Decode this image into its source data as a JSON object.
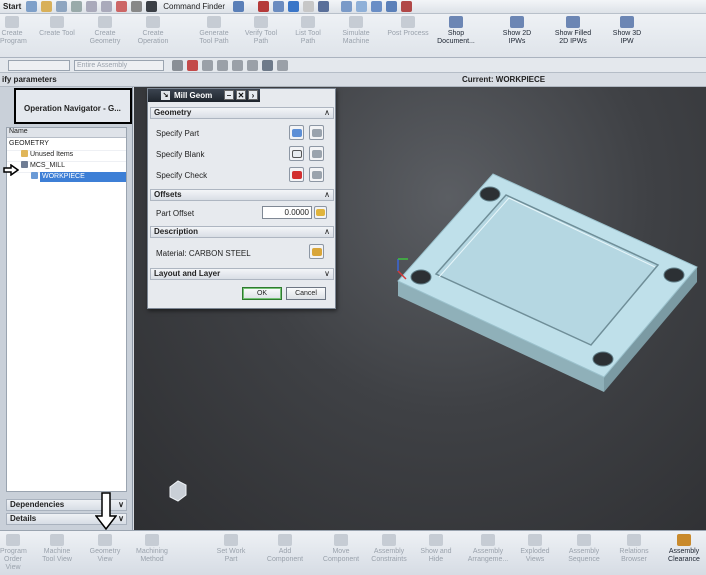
{
  "topbar": {
    "start_label": "Start",
    "command_finder_label": "Command Finder"
  },
  "ribbon": {
    "buttons": [
      {
        "label": "Create\nProgram"
      },
      {
        "label": "Create Tool"
      },
      {
        "label": "Create\nGeometry"
      },
      {
        "label": "Create\nOperation"
      },
      {
        "label": "Generate\nTool Path"
      },
      {
        "label": "Verify Tool\nPath"
      },
      {
        "label": "List Tool\nPath"
      },
      {
        "label": "Simulate\nMachine"
      },
      {
        "label": "Post Process"
      },
      {
        "label": "Shop\nDocument..."
      },
      {
        "label": "Show 2D\nIPWs"
      },
      {
        "label": "Show Filled\n2D IPWs"
      },
      {
        "label": "Show 3D\nIPW"
      }
    ]
  },
  "filterbar": {
    "assembly_select": "Entire Assembly"
  },
  "status": {
    "prompt": "ify parameters",
    "current": "Current: WORKPIECE"
  },
  "navigator": {
    "title": "Operation Navigator - G...",
    "column_header": "Name",
    "nodes": {
      "root": "GEOMETRY",
      "unused": "Unused Items",
      "mcs": "MCS_MILL",
      "workpiece": "WORKPIECE"
    },
    "sections": {
      "dependencies": "Dependencies",
      "details": "Details"
    }
  },
  "dialog": {
    "title": "Mill Geom",
    "groups": {
      "geometry": "Geometry",
      "offsets": "Offsets",
      "description": "Description",
      "layout": "Layout and Layer"
    },
    "rows": {
      "specify_part": "Specify Part",
      "specify_blank": "Specify Blank",
      "specify_check": "Specify Check",
      "part_offset": "Part Offset",
      "material": "Material: CARBON STEEL"
    },
    "part_offset_value": "0.0000",
    "ok_label": "OK",
    "cancel_label": "Cancel"
  },
  "bottombar": {
    "buttons": [
      {
        "label": "Program\nOrder View"
      },
      {
        "label": "Machine\nTool View"
      },
      {
        "label": "Geometry\nView"
      },
      {
        "label": "Machining\nMethod"
      },
      {
        "label": "Set Work\nPart"
      },
      {
        "label": "Add\nComponent"
      },
      {
        "label": "Move\nComponent"
      },
      {
        "label": "Assembly\nConstraints"
      },
      {
        "label": "Show and\nHide"
      },
      {
        "label": "Assembly\nArrangeme..."
      },
      {
        "label": "Exploded\nViews"
      },
      {
        "label": "Assembly\nSequence"
      },
      {
        "label": "Relations\nBrowser"
      },
      {
        "label": "Assembly\nClearance"
      }
    ]
  }
}
